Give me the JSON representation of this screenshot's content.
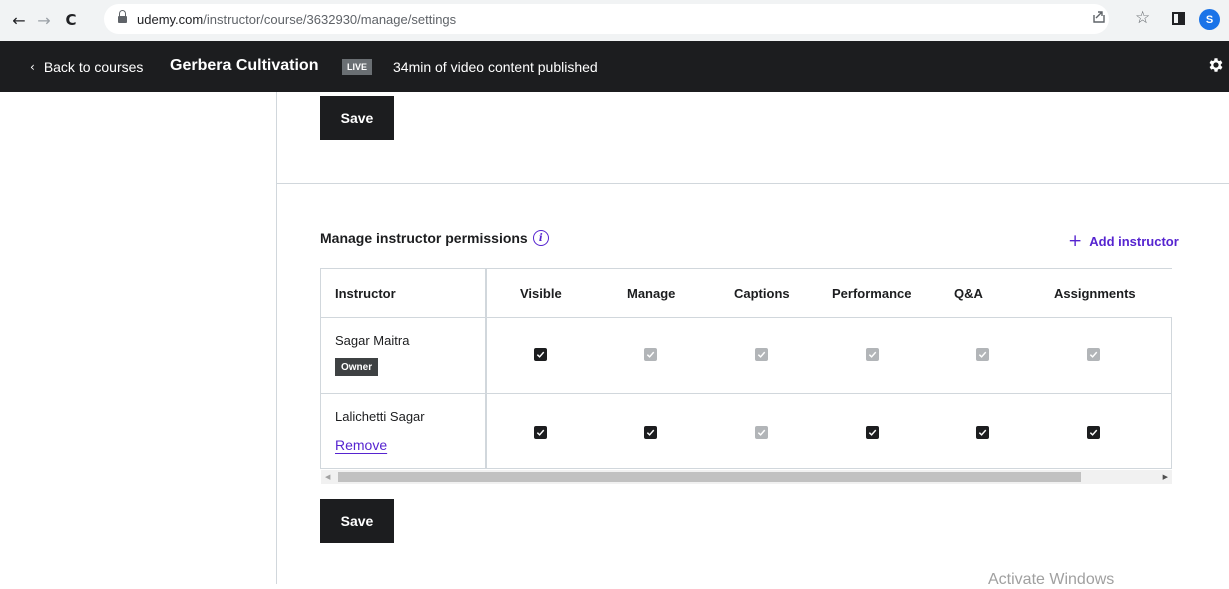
{
  "browser": {
    "url_host": "udemy.com",
    "url_path": "/instructor/course/3632930/manage/settings",
    "profile_initial": "S"
  },
  "header": {
    "back_label": "Back to courses",
    "course_title": "Gerbera Cultivation",
    "status_badge": "LIVE",
    "published_text": "34min of video content published"
  },
  "settings": {
    "save_label": "Save",
    "permissions_title": "Manage instructor permissions",
    "add_instructor_label": "Add instructor",
    "table": {
      "columns": [
        "Instructor",
        "Visible",
        "Manage",
        "Captions",
        "Performance",
        "Q&A",
        "Assignments"
      ],
      "rows": [
        {
          "name": "Sagar Maitra",
          "badge": "Owner",
          "permissions": {
            "Visible": "checked",
            "Manage": "checked-disabled",
            "Captions": "checked-disabled",
            "Performance": "checked-disabled",
            "Q&A": "checked-disabled",
            "Assignments": "checked-disabled"
          }
        },
        {
          "name": "Lalichetti Sagar",
          "action": "Remove",
          "permissions": {
            "Visible": "checked",
            "Manage": "checked",
            "Captions": "checked-disabled",
            "Performance": "checked",
            "Q&A": "checked",
            "Assignments": "checked"
          }
        }
      ]
    }
  },
  "colors": {
    "accent": "#5624d0",
    "dark": "#1c1d1f",
    "disabled_check": "#b2b5b8"
  },
  "watermark": "Activate Windows"
}
